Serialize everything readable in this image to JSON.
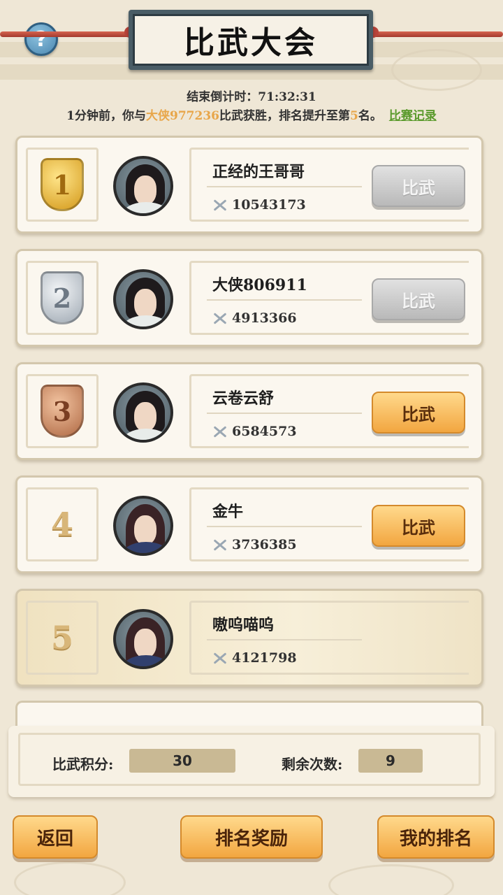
{
  "header": {
    "title": "比武大会",
    "help_label": "?"
  },
  "countdown": {
    "label": "结束倒计时：",
    "value": "71:32:31"
  },
  "news": {
    "prefix": "1分钟前，你与",
    "opponent": "大侠977236",
    "middle": "比武获胜，排名提升至第",
    "rank": "5",
    "suffix": "名。",
    "record_link": "比赛记录"
  },
  "ranking": [
    {
      "rank": "1",
      "name": "正经的王哥哥",
      "power": "10543173",
      "button": "比武",
      "button_enabled": false
    },
    {
      "rank": "2",
      "name": "大侠806911",
      "power": "4913366",
      "button": "比武",
      "button_enabled": false
    },
    {
      "rank": "3",
      "name": "云卷云舒",
      "power": "6584573",
      "button": "比武",
      "button_enabled": true
    },
    {
      "rank": "4",
      "name": "金牛",
      "power": "3736385",
      "button": "比武",
      "button_enabled": true
    },
    {
      "rank": "5",
      "name": "嗷呜喵呜",
      "power": "4121798"
    }
  ],
  "stats": {
    "score_label": "比武积分:",
    "score_value": "30",
    "remaining_label": "剩余次数:",
    "remaining_value": "9"
  },
  "buttons": {
    "back": "返回",
    "rank_reward": "排名奖励",
    "my_rank": "我的排名"
  },
  "colors": {
    "highlight": "#e8a64a",
    "link": "#5a9a2c",
    "button": "#f2a640"
  }
}
